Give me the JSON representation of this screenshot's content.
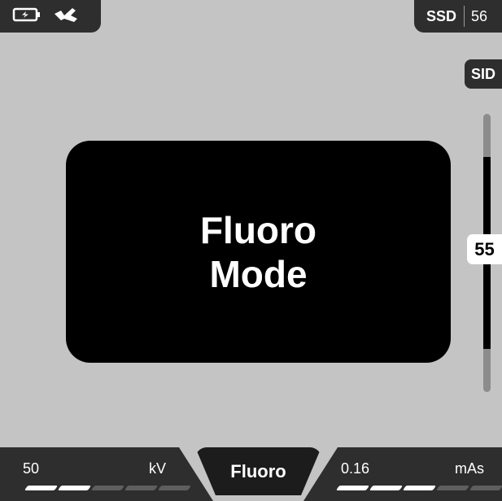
{
  "top_left": {
    "icons": [
      "battery-charging-icon",
      "handswitch-icon"
    ]
  },
  "top_right": {
    "label": "SSD",
    "value": "56"
  },
  "sid": {
    "label": "SID",
    "value": "55",
    "level": 0.42
  },
  "mode": {
    "line1": "Fluoro",
    "line2": "Mode"
  },
  "bottom": {
    "left": {
      "value": "50",
      "unit": "kV",
      "segments_total": 5,
      "segments_on": 2
    },
    "center": {
      "label": "Fluoro"
    },
    "right": {
      "value": "0.16",
      "unit": "mAs",
      "segments_total": 5,
      "segments_on": 3
    }
  },
  "colors": {
    "background": "#c4c4c4",
    "panel": "#2e2e2e",
    "active": "#000000",
    "text": "#ffffff"
  }
}
